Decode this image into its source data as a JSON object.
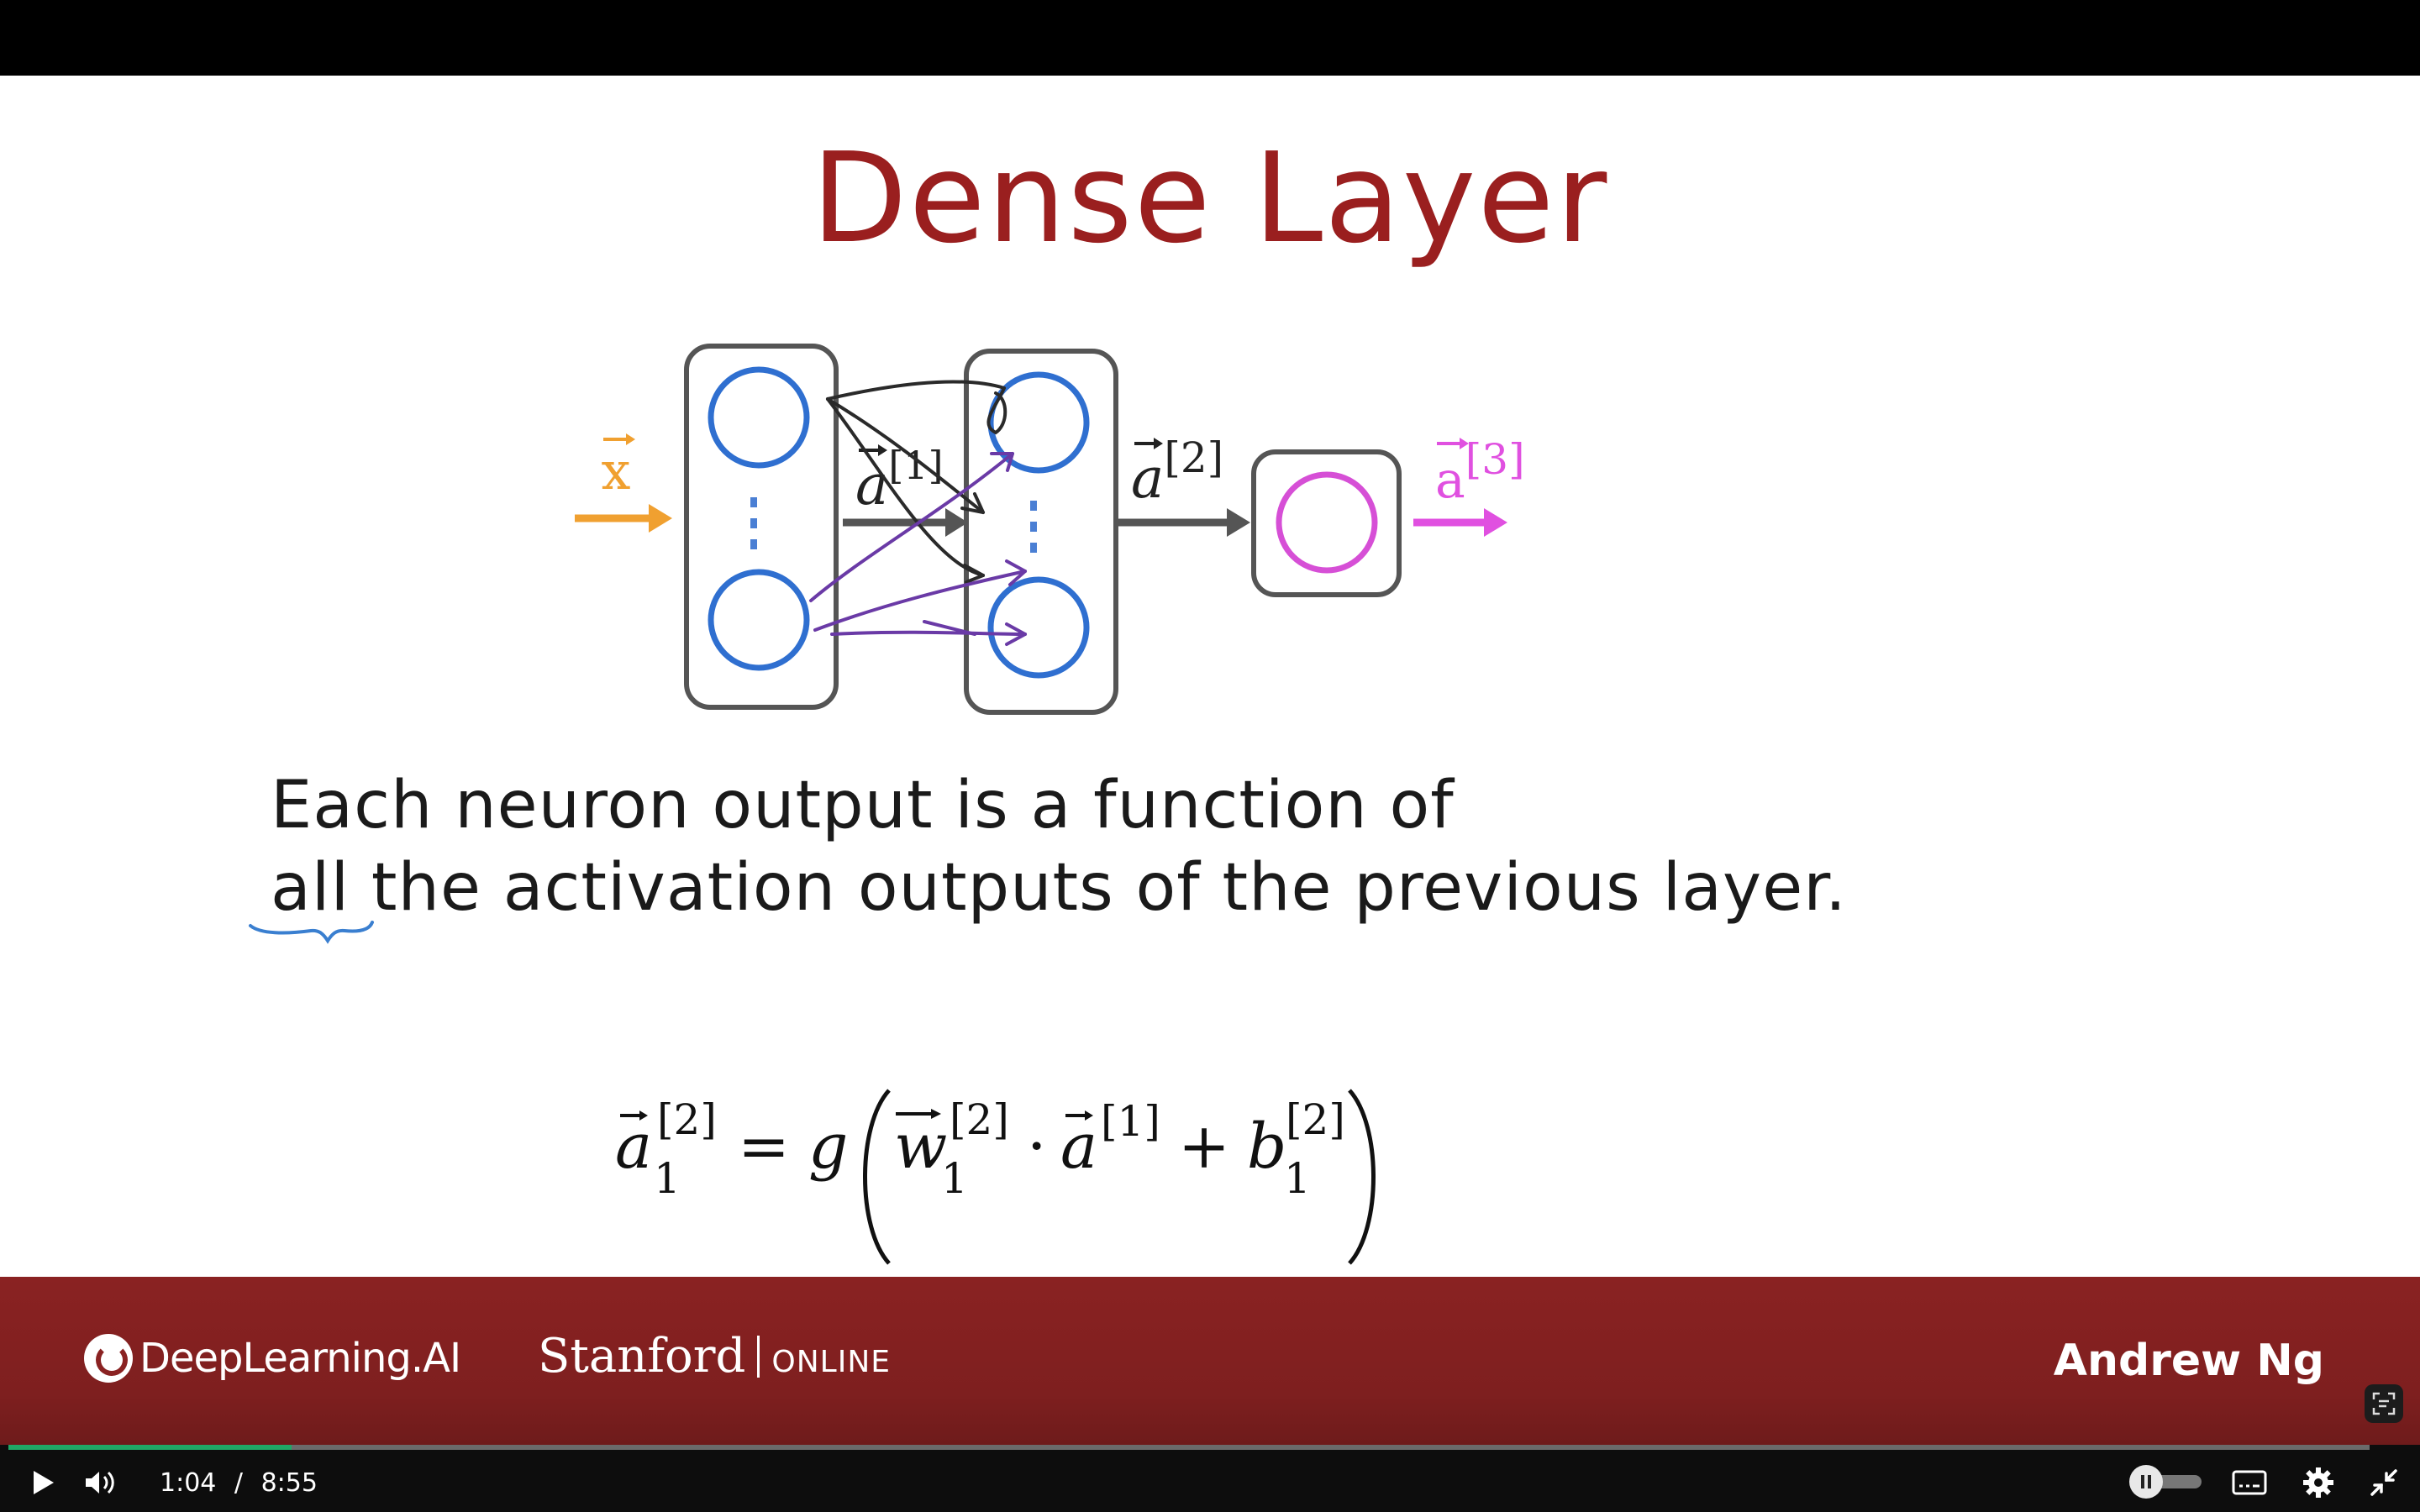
{
  "slide": {
    "title": "Dense Layer",
    "diagram": {
      "input_label": "x",
      "a1_label": "a",
      "a1_sup": "[1]",
      "a2_label": "a",
      "a2_sup": "[2]",
      "a3_label": "a",
      "a3_sup": "[3]",
      "colors": {
        "input": "#f0a030",
        "neuron": "#2f6fd0",
        "output": "#e050e0",
        "box": "#555555",
        "ink_black": "#222222",
        "ink_purple": "#6a3aa6"
      }
    },
    "caption_line1": "Each neuron output is a function of",
    "caption_line2_word": "all",
    "caption_line2_rest": " the activation outputs of the previous layer.",
    "formula": {
      "lhs": "a",
      "lhs_sup": "[2]",
      "lhs_sub": "1",
      "eq": "=",
      "g": "g",
      "w": "w",
      "w_sup": "[2]",
      "w_sub": "1",
      "dot": "·",
      "a": "a",
      "a_sup": "[1]",
      "plus": "+",
      "b": "b",
      "b_sup": "[2]",
      "b_sub": "1"
    }
  },
  "footer": {
    "deeplearning": "DeepLearning.AI",
    "stanford": "Stanford",
    "online": "ONLINE",
    "presenter": "Andrew Ng"
  },
  "player": {
    "current_time": "1:04",
    "separator": "/",
    "duration": "8:55",
    "progress_fraction": 0.12,
    "accent": "#1fa866"
  }
}
